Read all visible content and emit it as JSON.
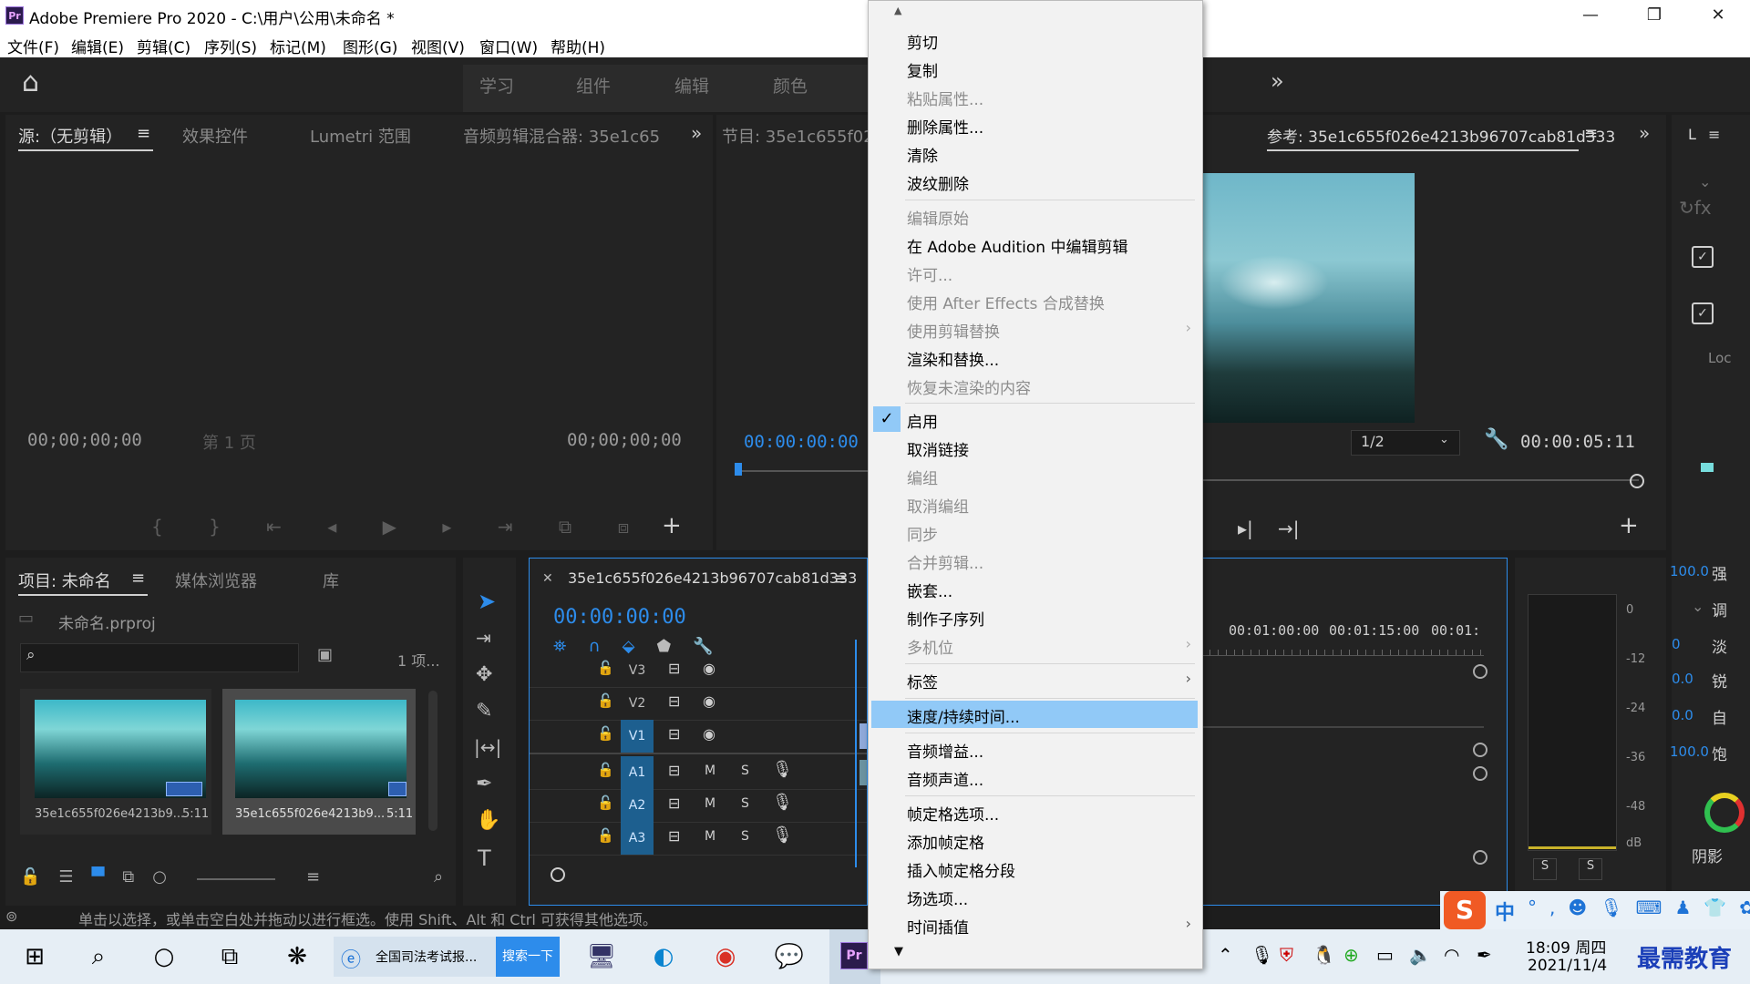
{
  "window": {
    "title": "Adobe Premiere Pro 2020 - C:\\用户\\公用\\未命名 *",
    "logo": "Pr",
    "minimize": "—",
    "restore": "❐",
    "close": "✕"
  },
  "menubar": [
    "文件(F)",
    "编辑(E)",
    "剪辑(C)",
    "序列(S)",
    "标记(M)",
    "图形(G)",
    "视图(V)",
    "窗口(W)",
    "帮助(H)"
  ],
  "workspaces": {
    "home": "⌂",
    "tabs": [
      "学习",
      "组件",
      "编辑",
      "颜色"
    ],
    "more": "»"
  },
  "source_panel": {
    "tabs": [
      "源:（无剪辑）",
      "效果控件",
      "Lumetri 范围",
      "音频剪辑混合器: 35e1c65"
    ],
    "more": "»",
    "timecode_left": "00;00;00;00",
    "page_label": "第 1 页",
    "timecode_right": "00;00;00;00",
    "add": "+"
  },
  "program_panel": {
    "tab": "节目: 35e1c655f026e",
    "timecode": "00:00:00:00"
  },
  "reference_panel": {
    "tab": "参考: 35e1c655f026e4213b96707cab81d333",
    "more": "»",
    "zoom": "1/2",
    "duration": "00:00:05:11",
    "add": "+"
  },
  "right_panel": {
    "header": "L",
    "mode_label": "强",
    "values": [
      {
        "value": "100.0",
        "label": "强"
      },
      {
        "value": "0",
        "label": "调"
      },
      {
        "value": "0",
        "label": "淡"
      },
      {
        "value": "0.0",
        "label": "锐"
      },
      {
        "value": "0.0",
        "label": "自"
      },
      {
        "value": "100.0",
        "label": "饱"
      }
    ],
    "loc": "Loc",
    "shadow_label": "阴影"
  },
  "project_panel": {
    "tabs": [
      "项目: 未命名",
      "媒体浏览器",
      "库"
    ],
    "file": "未命名.prproj",
    "count": "1 项...",
    "items": [
      {
        "name": "35e1c655f026e4213b9...",
        "duration": "5:11"
      },
      {
        "name": "35e1c655f026e4213b9...",
        "duration": "5:11"
      }
    ]
  },
  "timeline": {
    "sequence": "35e1c655f026e4213b96707cab81d333",
    "timecode": "00:00:00:00",
    "ruler": [
      "00:01:00:00",
      "00:01:15:00",
      "00:01:"
    ],
    "tracks": [
      {
        "name": "V3",
        "type": "video"
      },
      {
        "name": "V2",
        "type": "video"
      },
      {
        "name": "V1",
        "type": "video"
      },
      {
        "name": "A1",
        "type": "audio"
      },
      {
        "name": "A2",
        "type": "audio"
      },
      {
        "name": "A3",
        "type": "audio"
      }
    ],
    "mute": "M",
    "solo": "S"
  },
  "meter": {
    "scale": [
      "0",
      "-12",
      "-24",
      "-36",
      "-48",
      "dB"
    ],
    "solo": [
      "S",
      "S"
    ]
  },
  "statusbar": "单击以选择，或单击空白处并拖动以进行框选。使用 Shift、Alt 和 Ctrl 可获得其他选项。",
  "context_menu": {
    "items": [
      {
        "label": "剪切",
        "enabled": true
      },
      {
        "label": "复制",
        "enabled": true
      },
      {
        "label": "粘贴属性...",
        "enabled": false
      },
      {
        "label": "删除属性...",
        "enabled": true
      },
      {
        "label": "清除",
        "enabled": true
      },
      {
        "label": "波纹删除",
        "enabled": true
      },
      {
        "label": "编辑原始",
        "enabled": false
      },
      {
        "label": "在 Adobe Audition 中编辑剪辑",
        "enabled": true
      },
      {
        "label": "许可...",
        "enabled": false
      },
      {
        "label": "使用 After Effects 合成替换",
        "enabled": false
      },
      {
        "label": "使用剪辑替换",
        "enabled": false,
        "submenu": true
      },
      {
        "label": "渲染和替换...",
        "enabled": true
      },
      {
        "label": "恢复未渲染的内容",
        "enabled": false
      },
      {
        "label": "启用",
        "enabled": true,
        "checked": true
      },
      {
        "label": "取消链接",
        "enabled": true
      },
      {
        "label": "编组",
        "enabled": false
      },
      {
        "label": "取消编组",
        "enabled": false
      },
      {
        "label": "同步",
        "enabled": false
      },
      {
        "label": "合并剪辑...",
        "enabled": false
      },
      {
        "label": "嵌套...",
        "enabled": true
      },
      {
        "label": "制作子序列",
        "enabled": true
      },
      {
        "label": "多机位",
        "enabled": false,
        "submenu": true
      },
      {
        "label": "标签",
        "enabled": true,
        "submenu": true
      },
      {
        "label": "速度/持续时间...",
        "enabled": true,
        "highlighted": true
      },
      {
        "label": "音频增益...",
        "enabled": true
      },
      {
        "label": "音频声道...",
        "enabled": true
      },
      {
        "label": "帧定格选项...",
        "enabled": true
      },
      {
        "label": "添加帧定格",
        "enabled": true
      },
      {
        "label": "插入帧定格分段",
        "enabled": true
      },
      {
        "label": "场选项...",
        "enabled": true
      },
      {
        "label": "时间插值",
        "enabled": true,
        "submenu": true
      }
    ],
    "scroll_up": "▲",
    "scroll_down": "▼"
  },
  "taskbar": {
    "search_task": "全国司法考试报...",
    "search_button": "搜索一下",
    "time": "18:09 周四",
    "date": "2021/11/4",
    "ime": "中",
    "watermark": "最需教育"
  }
}
